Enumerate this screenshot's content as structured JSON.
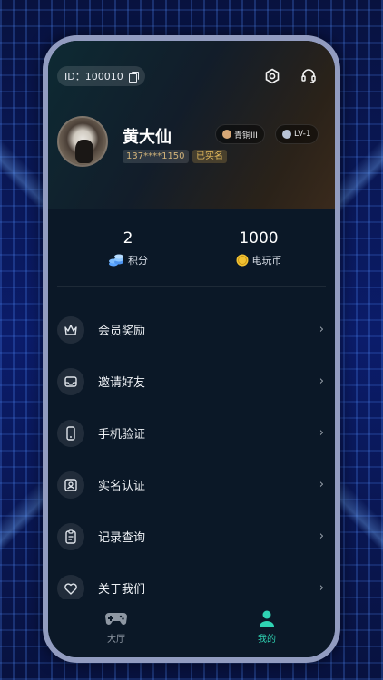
{
  "profile": {
    "id_text": "ID：100010",
    "name": "黄大仙",
    "phone": "137****1150",
    "verified": "已实名",
    "rank": "青铜III",
    "level": "LV-1"
  },
  "stats": {
    "points_value": "2",
    "points_label": "积分",
    "coins_value": "1000",
    "coins_label": "电玩币"
  },
  "menu": {
    "items": [
      {
        "label": "会员奖励",
        "icon": "crown-icon"
      },
      {
        "label": "邀请好友",
        "icon": "inbox-icon"
      },
      {
        "label": "手机验证",
        "icon": "phone-icon"
      },
      {
        "label": "实名认证",
        "icon": "id-card-icon"
      },
      {
        "label": "记录查询",
        "icon": "clipboard-icon"
      },
      {
        "label": "关于我们",
        "icon": "heart-icon"
      }
    ],
    "chevron": "›"
  },
  "tabbar": {
    "hall_label": "大厅",
    "mine_label": "我的"
  },
  "colors": {
    "accent": "#2fd3b3",
    "verified": "#e1b85c",
    "card_bg": "#0b1827"
  }
}
